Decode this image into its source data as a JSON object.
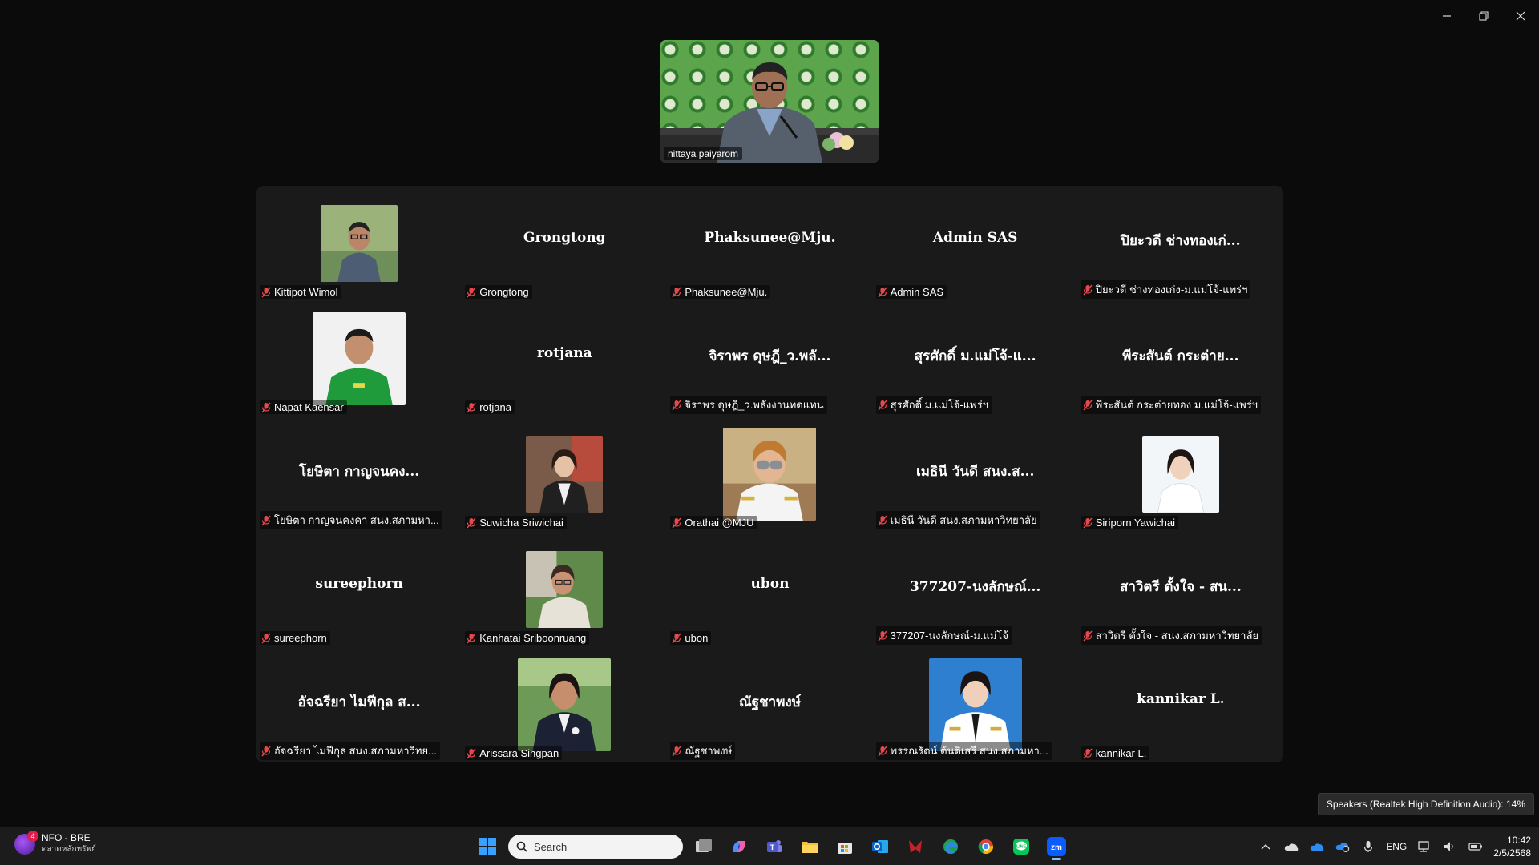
{
  "window": {
    "minimize": "minimize-icon",
    "restore": "restore-icon",
    "close": "close-icon"
  },
  "speaker": {
    "name": "nittaya paiyarom"
  },
  "tiles": [
    {
      "display": "",
      "label": "Kittipot Wimol",
      "photo": "photo-man-glasses"
    },
    {
      "display": "Grongtong",
      "label": "Grongtong"
    },
    {
      "display": "Phaksunee@Mju.",
      "label": "Phaksunee@Mju."
    },
    {
      "display": "Admin SAS",
      "label": "Admin SAS"
    },
    {
      "display": "ปิยะวดี ช่างทองเก่...",
      "label": "ปิยะวดี ช่างทองเก่ง-ม.แม่โจ้-แพร่ฯ"
    },
    {
      "display": "",
      "label": "Napat Kaensar",
      "photo": "photo-man-green-shirt"
    },
    {
      "display": "rotjana",
      "label": "rotjana"
    },
    {
      "display": "จิราพร ดุษฎี_ว.พลั...",
      "label": "จิราพร ดุษฎี_ว.พลังงานทดแทน"
    },
    {
      "display": "สุรศักดิ์ ม.แม่โจ้-แ...",
      "label": "สุรศักดิ์ ม.แม่โจ้-แพร่ฯ"
    },
    {
      "display": "พีระสันต์ กระต่าย...",
      "label": "พีระสันต์ กระต่ายทอง ม.แม่โจ้-แพร่ฯ"
    },
    {
      "display": "โยษิตา กาญจนคง...",
      "label": "โยษิตา กาญจนคงคา สนง.สภามหา..."
    },
    {
      "display": "",
      "label": "Suwicha Sriwichai",
      "photo": "photo-woman-office"
    },
    {
      "display": "",
      "label": "Orathai @MJU",
      "photo": "photo-woman-sunglasses"
    },
    {
      "display": "เมธินี วันดี สนง.ส...",
      "label": "เมธินี วันดี สนง.สภามหาวิทยาลัย"
    },
    {
      "display": "",
      "label": "Siriporn Yawichai",
      "photo": "photo-woman-white-bg"
    },
    {
      "display": "sureephorn",
      "label": "sureephorn"
    },
    {
      "display": "",
      "label": "Kanhatai Sriboonruang",
      "photo": "photo-woman-garden"
    },
    {
      "display": "ubon",
      "label": "ubon"
    },
    {
      "display": "377207-นงลักษณ์...",
      "label": "377207-นงลักษณ์-ม.แม่โจ้"
    },
    {
      "display": "สาวิตรี ตั้งใจ - สน...",
      "label": "สาวิตรี ตั้งใจ - สนง.สภามหาวิทยาลัย"
    },
    {
      "display": "อัจฉรียา ไมฟีกุล ส...",
      "label": "อัจฉรียา ไมฟีกุล สนง.สภามหาวิทย..."
    },
    {
      "display": "",
      "label": "Arissara Singpan",
      "photo": "photo-woman-outdoor"
    },
    {
      "display": "ณัฐชาพงษ์",
      "label": "ณัฐชาพงษ์"
    },
    {
      "display": "",
      "label": "พรรณรัตน์ ต้นติเสรี สนง.สภามหา...",
      "photo": "photo-woman-uniform"
    },
    {
      "display": "kannikar L.",
      "label": "kannikar L."
    }
  ],
  "tooltip": "Speakers (Realtek High Definition Audio): 14%",
  "taskbar": {
    "news_badge": "4",
    "news_title": "NFO - BRE",
    "news_sub": "ตลาดหลักทรัพย์",
    "search_placeholder": "Search",
    "lang": "ENG",
    "time": "10:42",
    "date": "2/5/2568"
  },
  "colors": {
    "gallery_bg": "#1a1a1a",
    "mute_red": "#e5484d",
    "zoom_blue": "#0b5cff"
  }
}
